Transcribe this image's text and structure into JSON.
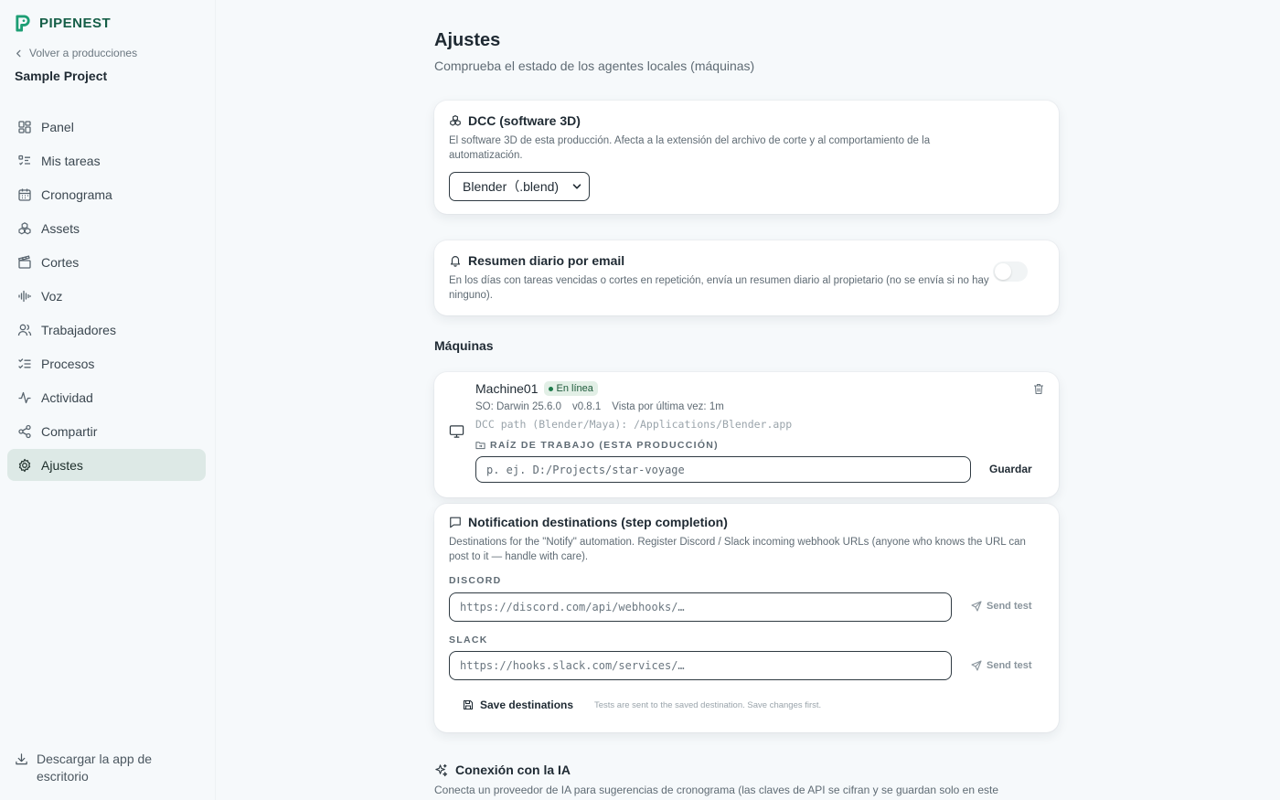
{
  "brand": {
    "name": "PIPENEST",
    "color": "#1d9e74"
  },
  "sidebar": {
    "back_label": "Volver a producciones",
    "project_name": "Sample Project",
    "items": [
      {
        "label": "Panel",
        "icon": "grid-icon"
      },
      {
        "label": "Mis tareas",
        "icon": "list-todo-icon"
      },
      {
        "label": "Cronograma",
        "icon": "calendar-icon"
      },
      {
        "label": "Assets",
        "icon": "boxes-icon"
      },
      {
        "label": "Cortes",
        "icon": "clapperboard-icon"
      },
      {
        "label": "Voz",
        "icon": "audio-wave-icon"
      },
      {
        "label": "Trabajadores",
        "icon": "users-icon"
      },
      {
        "label": "Procesos",
        "icon": "list-checks-icon"
      },
      {
        "label": "Actividad",
        "icon": "activity-icon"
      },
      {
        "label": "Compartir",
        "icon": "share-icon"
      },
      {
        "label": "Ajustes",
        "icon": "gear-icon",
        "active": true
      }
    ],
    "download_label": "Descargar la app de escritorio"
  },
  "page": {
    "title": "Ajustes",
    "subtitle": "Comprueba el estado de los agentes locales (máquinas)"
  },
  "dcc": {
    "title": "DCC (software 3D)",
    "description": "El software 3D de esta producción. Afecta a la extensión del archivo de corte y al comportamiento de la automatización.",
    "selected": "Blender（.blend)"
  },
  "email_summary": {
    "title": "Resumen diario por email",
    "description": "En los días con tareas vencidas o cortes en repetición, envía un resumen diario al propietario (no se envía si no hay ninguno).",
    "enabled": false
  },
  "machines": {
    "section_title": "Máquinas",
    "items": [
      {
        "name": "Machine01",
        "status": "En línea",
        "os": "SO: Darwin 25.6.0",
        "version": "v0.8.1",
        "last_seen": "Vista por última vez: 1m",
        "dcc_path": "DCC path (Blender/Maya): /Applications/Blender.app",
        "work_root_label": "RAÍZ DE TRABAJO (ESTA PRODUCCIÓN)",
        "work_root_placeholder": "p. ej. D:/Projects/star-voyage",
        "save_label": "Guardar"
      }
    ]
  },
  "notifications": {
    "title": "Notification destinations (step completion)",
    "description": "Destinations for the \"Notify\" automation. Register Discord / Slack incoming webhook URLs (anyone who knows the URL can post to it — handle with care).",
    "discord_label": "DISCORD",
    "discord_placeholder": "https://discord.com/api/webhooks/…",
    "slack_label": "SLACK",
    "slack_placeholder": "https://hooks.slack.com/services/…",
    "send_test_label": "Send test",
    "save_label": "Save destinations",
    "hint": "Tests are sent to the saved destination. Save changes first."
  },
  "ai": {
    "title": "Conexión con la IA",
    "description": "Conecta un proveedor de IA para sugerencias de cronograma (las claves de API se cifran y se guardan solo en este"
  }
}
